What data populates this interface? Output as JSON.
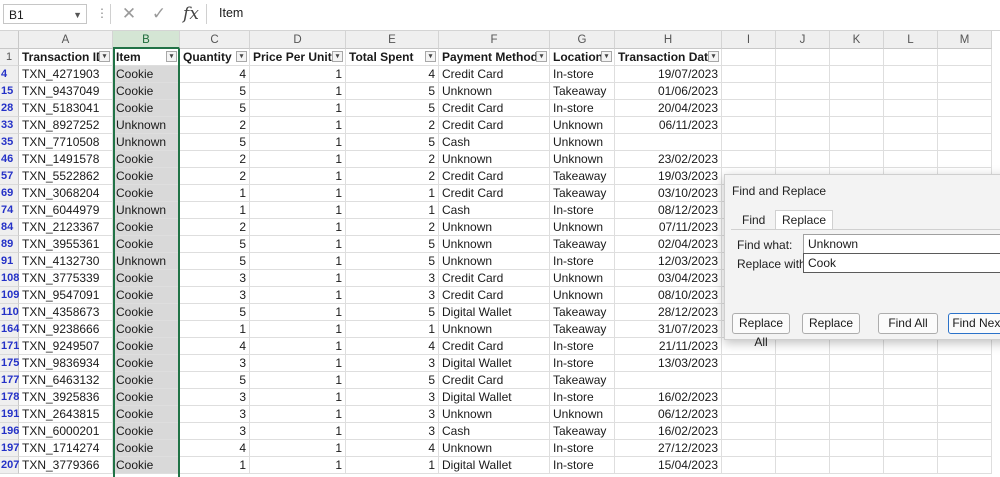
{
  "formula_bar": {
    "name_box": "B1",
    "cancel_icon": "close-icon",
    "enter_icon": "check-icon",
    "function_icon": "fx",
    "content": "Item"
  },
  "columns": [
    "A",
    "B",
    "C",
    "D",
    "E",
    "F",
    "G",
    "H",
    "I",
    "J",
    "K",
    "L",
    "M"
  ],
  "selected_column": "B",
  "header_row_number": "1",
  "headers": [
    "Transaction ID",
    "Item",
    "Quantity",
    "Price Per Unit",
    "Total Spent",
    "Payment Method",
    "Location",
    "Transaction Date"
  ],
  "rows": [
    {
      "n": "4",
      "id": "TXN_4271903",
      "item": "Cookie",
      "qty": "4",
      "ppu": "1",
      "total": "4",
      "pay": "Credit Card",
      "loc": "In-store",
      "date": "19/07/2023"
    },
    {
      "n": "15",
      "id": "TXN_9437049",
      "item": "Cookie",
      "qty": "5",
      "ppu": "1",
      "total": "5",
      "pay": "Unknown",
      "loc": "Takeaway",
      "date": "01/06/2023"
    },
    {
      "n": "28",
      "id": "TXN_5183041",
      "item": "Cookie",
      "qty": "5",
      "ppu": "1",
      "total": "5",
      "pay": "Credit Card",
      "loc": "In-store",
      "date": "20/04/2023"
    },
    {
      "n": "33",
      "id": "TXN_8927252",
      "item": "Unknown",
      "qty": "2",
      "ppu": "1",
      "total": "2",
      "pay": "Credit Card",
      "loc": "Unknown",
      "date": "06/11/2023"
    },
    {
      "n": "35",
      "id": "TXN_7710508",
      "item": "Unknown",
      "qty": "5",
      "ppu": "1",
      "total": "5",
      "pay": "Cash",
      "loc": "Unknown",
      "date": ""
    },
    {
      "n": "46",
      "id": "TXN_1491578",
      "item": "Cookie",
      "qty": "2",
      "ppu": "1",
      "total": "2",
      "pay": "Unknown",
      "loc": "Unknown",
      "date": "23/02/2023"
    },
    {
      "n": "57",
      "id": "TXN_5522862",
      "item": "Cookie",
      "qty": "2",
      "ppu": "1",
      "total": "2",
      "pay": "Credit Card",
      "loc": "Takeaway",
      "date": "19/03/2023"
    },
    {
      "n": "69",
      "id": "TXN_3068204",
      "item": "Cookie",
      "qty": "1",
      "ppu": "1",
      "total": "1",
      "pay": "Credit Card",
      "loc": "Takeaway",
      "date": "03/10/2023"
    },
    {
      "n": "74",
      "id": "TXN_6044979",
      "item": "Unknown",
      "qty": "1",
      "ppu": "1",
      "total": "1",
      "pay": "Cash",
      "loc": "In-store",
      "date": "08/12/2023"
    },
    {
      "n": "84",
      "id": "TXN_2123367",
      "item": "Cookie",
      "qty": "2",
      "ppu": "1",
      "total": "2",
      "pay": "Unknown",
      "loc": "Unknown",
      "date": "07/11/2023"
    },
    {
      "n": "89",
      "id": "TXN_3955361",
      "item": "Cookie",
      "qty": "5",
      "ppu": "1",
      "total": "5",
      "pay": "Unknown",
      "loc": "Takeaway",
      "date": "02/04/2023"
    },
    {
      "n": "91",
      "id": "TXN_4132730",
      "item": "Unknown",
      "qty": "5",
      "ppu": "1",
      "total": "5",
      "pay": "Unknown",
      "loc": "In-store",
      "date": "12/03/2023"
    },
    {
      "n": "108",
      "id": "TXN_3775339",
      "item": "Cookie",
      "qty": "3",
      "ppu": "1",
      "total": "3",
      "pay": "Credit Card",
      "loc": "Unknown",
      "date": "03/04/2023"
    },
    {
      "n": "109",
      "id": "TXN_9547091",
      "item": "Cookie",
      "qty": "3",
      "ppu": "1",
      "total": "3",
      "pay": "Credit Card",
      "loc": "Unknown",
      "date": "08/10/2023"
    },
    {
      "n": "110",
      "id": "TXN_4358673",
      "item": "Cookie",
      "qty": "5",
      "ppu": "1",
      "total": "5",
      "pay": "Digital Wallet",
      "loc": "Takeaway",
      "date": "28/12/2023"
    },
    {
      "n": "164",
      "id": "TXN_9238666",
      "item": "Cookie",
      "qty": "1",
      "ppu": "1",
      "total": "1",
      "pay": "Unknown",
      "loc": "Takeaway",
      "date": "31/07/2023"
    },
    {
      "n": "171",
      "id": "TXN_9249507",
      "item": "Cookie",
      "qty": "4",
      "ppu": "1",
      "total": "4",
      "pay": "Credit Card",
      "loc": "In-store",
      "date": "21/11/2023"
    },
    {
      "n": "175",
      "id": "TXN_9836934",
      "item": "Cookie",
      "qty": "3",
      "ppu": "1",
      "total": "3",
      "pay": "Digital Wallet",
      "loc": "In-store",
      "date": "13/03/2023"
    },
    {
      "n": "177",
      "id": "TXN_6463132",
      "item": "Cookie",
      "qty": "5",
      "ppu": "1",
      "total": "5",
      "pay": "Credit Card",
      "loc": "Takeaway",
      "date": ""
    },
    {
      "n": "178",
      "id": "TXN_3925836",
      "item": "Cookie",
      "qty": "3",
      "ppu": "1",
      "total": "3",
      "pay": "Digital Wallet",
      "loc": "In-store",
      "date": "16/02/2023"
    },
    {
      "n": "191",
      "id": "TXN_2643815",
      "item": "Cookie",
      "qty": "3",
      "ppu": "1",
      "total": "3",
      "pay": "Unknown",
      "loc": "Unknown",
      "date": "06/12/2023"
    },
    {
      "n": "196",
      "id": "TXN_6000201",
      "item": "Cookie",
      "qty": "3",
      "ppu": "1",
      "total": "3",
      "pay": "Cash",
      "loc": "Takeaway",
      "date": "16/02/2023"
    },
    {
      "n": "197",
      "id": "TXN_1714274",
      "item": "Cookie",
      "qty": "4",
      "ppu": "1",
      "total": "4",
      "pay": "Unknown",
      "loc": "In-store",
      "date": "27/12/2023"
    },
    {
      "n": "207",
      "id": "TXN_3779366",
      "item": "Cookie",
      "qty": "1",
      "ppu": "1",
      "total": "1",
      "pay": "Digital Wallet",
      "loc": "In-store",
      "date": "15/04/2023"
    }
  ],
  "dialog": {
    "title": "Find and Replace",
    "tabs": [
      "Find",
      "Replace"
    ],
    "active_tab": "Replace",
    "find_label": "Find what:",
    "find_value": "Unknown",
    "replace_label": "Replace with:",
    "replace_value": "Cook",
    "buttons": [
      "Replace All",
      "Replace",
      "Find All",
      "Find Next"
    ]
  },
  "colors": {
    "selection_green": "#217346",
    "row_number_blue": "#2431c7",
    "selected_fill": "#d9d9d9"
  }
}
